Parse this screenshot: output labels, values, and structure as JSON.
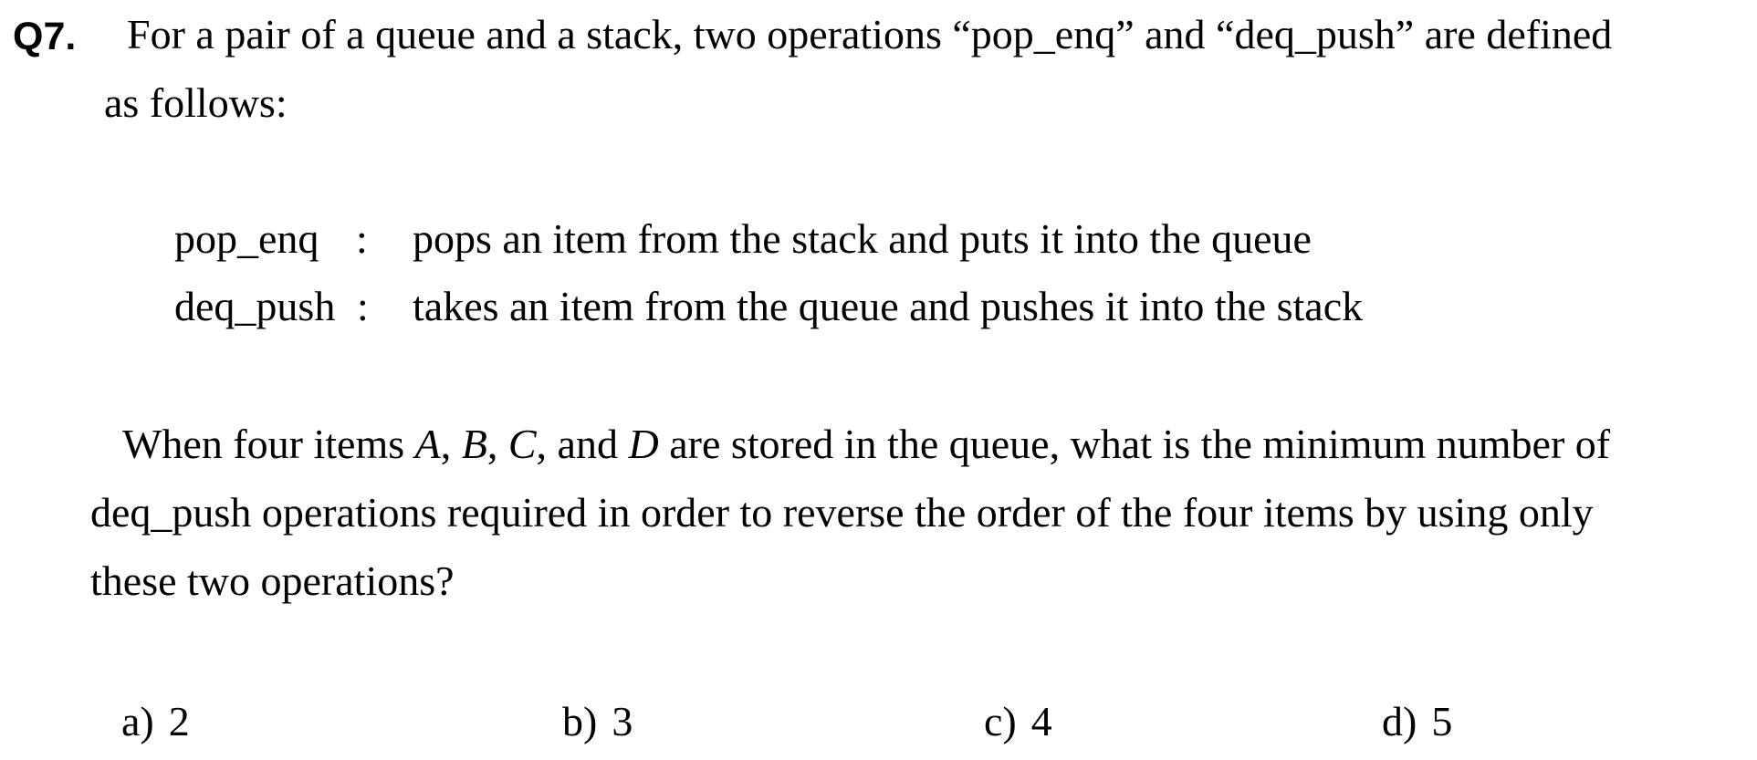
{
  "question": {
    "number": "Q7.",
    "intro_line1": "For a pair of a queue and a stack, two operations “pop_enq” and “deq_push” are defined",
    "intro_line2": "as follows:",
    "definitions": [
      {
        "term": "pop_enq",
        "colon": ":",
        "description": "pops an item from the stack and puts it into the queue"
      },
      {
        "term": "deq_push",
        "colon": ":",
        "description": "takes an item from the queue and pushes it into the stack"
      }
    ],
    "prompt": {
      "line1_pre": "When four items ",
      "item_a": "A",
      "sep1": ", ",
      "item_b": "B",
      "sep2": ", ",
      "item_c": "C",
      "sep3": ", and ",
      "item_d": "D",
      "line1_post": " are stored in the queue, what is the minimum number of",
      "line2": "deq_push operations required in order to reverse the order of the four items by using only",
      "line3": "these two operations?"
    },
    "options": [
      {
        "label": "a)",
        "value": "2"
      },
      {
        "label": "b)",
        "value": "3"
      },
      {
        "label": "c)",
        "value": "4"
      },
      {
        "label": "d)",
        "value": "5"
      }
    ]
  }
}
